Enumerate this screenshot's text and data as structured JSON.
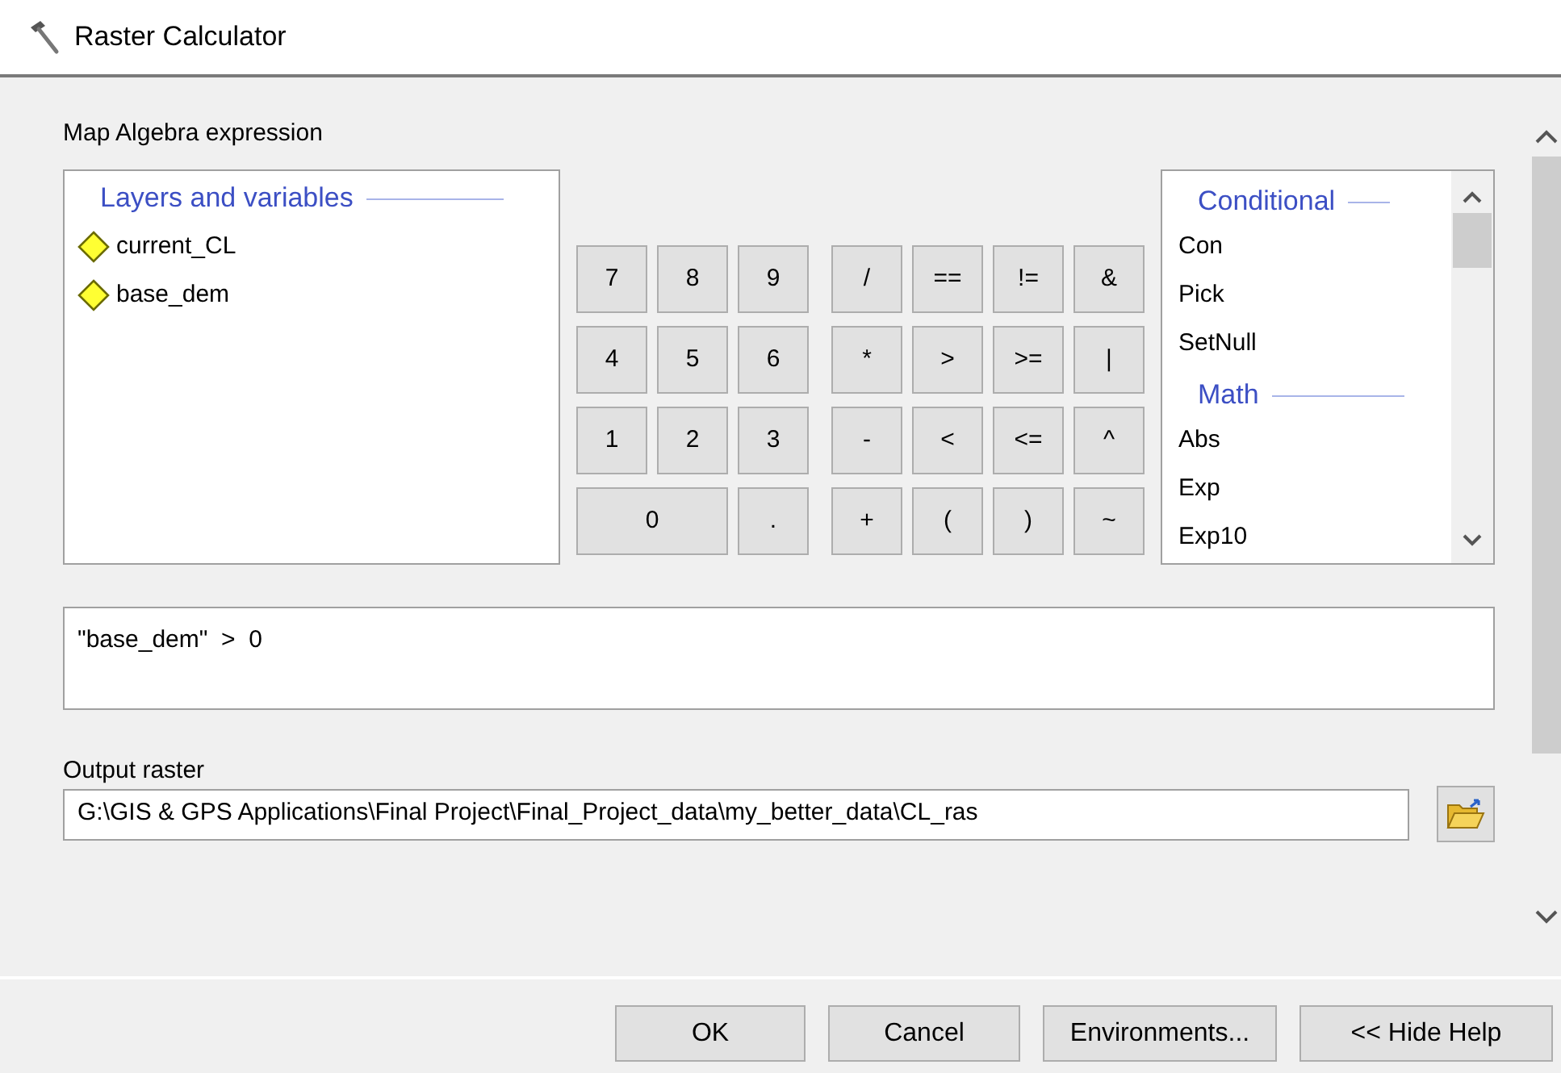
{
  "window": {
    "title": "Raster Calculator"
  },
  "expression_label": "Map Algebra expression",
  "layers": {
    "heading": "Layers and variables",
    "items": [
      {
        "label": "current_CL"
      },
      {
        "label": "base_dem"
      }
    ]
  },
  "digit_keys": [
    {
      "label": "7",
      "wide": false
    },
    {
      "label": "8",
      "wide": false
    },
    {
      "label": "9",
      "wide": false
    },
    {
      "label": "4",
      "wide": false
    },
    {
      "label": "5",
      "wide": false
    },
    {
      "label": "6",
      "wide": false
    },
    {
      "label": "1",
      "wide": false
    },
    {
      "label": "2",
      "wide": false
    },
    {
      "label": "3",
      "wide": false
    },
    {
      "label": "0",
      "wide": true
    },
    {
      "label": ".",
      "wide": false
    }
  ],
  "operator_keys": [
    "/",
    "==",
    "!=",
    "&",
    "*",
    ">",
    ">=",
    "|",
    "-",
    "<",
    "<=",
    "^",
    "+",
    "(",
    ")",
    "~"
  ],
  "functions": [
    {
      "heading": "Conditional",
      "items": [
        "Con",
        "Pick",
        "SetNull"
      ]
    },
    {
      "heading": "Math",
      "items": [
        "Abs",
        "Exp",
        "Exp10"
      ]
    }
  ],
  "expression": "\"base_dem\"  >  0",
  "output": {
    "label": "Output raster",
    "value": "G:\\GIS & GPS Applications\\Final Project\\Final_Project_data\\my_better_data\\CL_ras"
  },
  "buttons": [
    "OK",
    "Cancel",
    "Environments...",
    "<< Hide Help"
  ]
}
